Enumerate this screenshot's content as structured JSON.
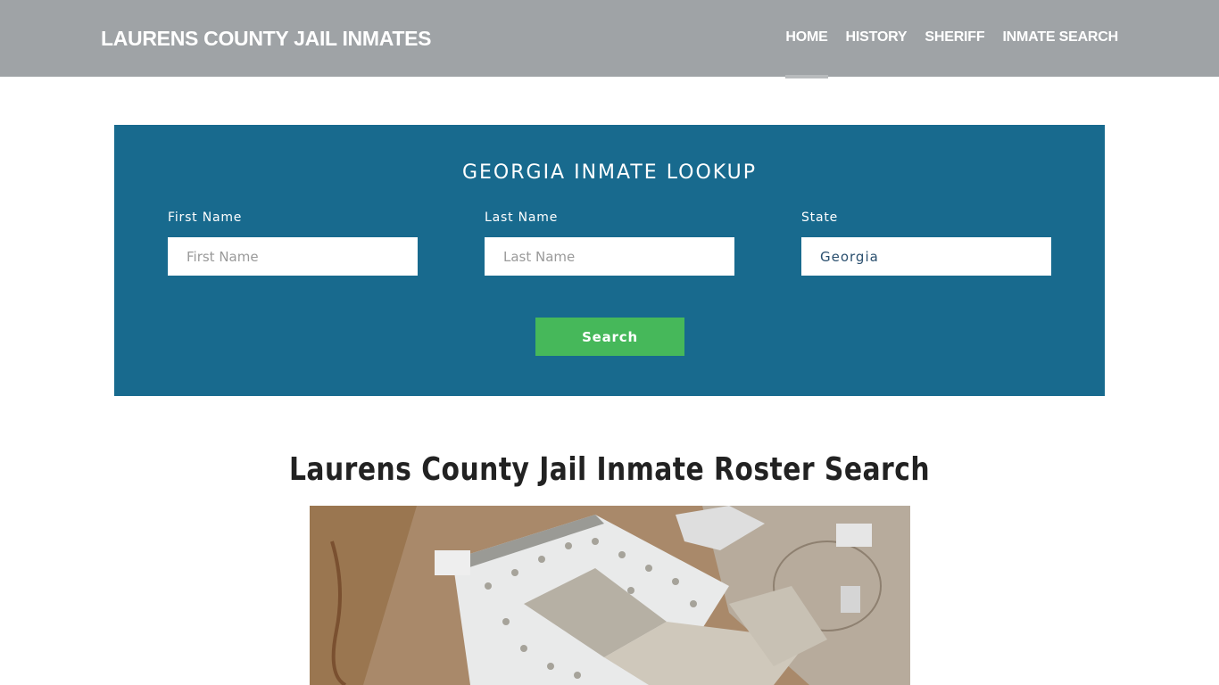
{
  "header": {
    "brand": "LAURENS COUNTY JAIL INMATES",
    "nav": [
      {
        "label": "HOME",
        "active": true
      },
      {
        "label": "HISTORY",
        "active": false
      },
      {
        "label": "SHERIFF",
        "active": false
      },
      {
        "label": "INMATE SEARCH",
        "active": false
      }
    ]
  },
  "lookup": {
    "title": "GEORGIA INMATE LOOKUP",
    "first_name": {
      "label": "First Name",
      "placeholder": "First Name",
      "value": ""
    },
    "last_name": {
      "label": "Last Name",
      "placeholder": "Last Name",
      "value": ""
    },
    "state": {
      "label": "State",
      "value": "Georgia"
    },
    "search_label": "Search",
    "colors": {
      "panel": "#186a8e",
      "button": "#46b85a"
    }
  },
  "main": {
    "title": "Laurens County Jail Inmate Roster Search",
    "image_alt": "aerial-view-of-jail-facility"
  },
  "theme": {
    "header_bg": "#9fa3a6"
  }
}
